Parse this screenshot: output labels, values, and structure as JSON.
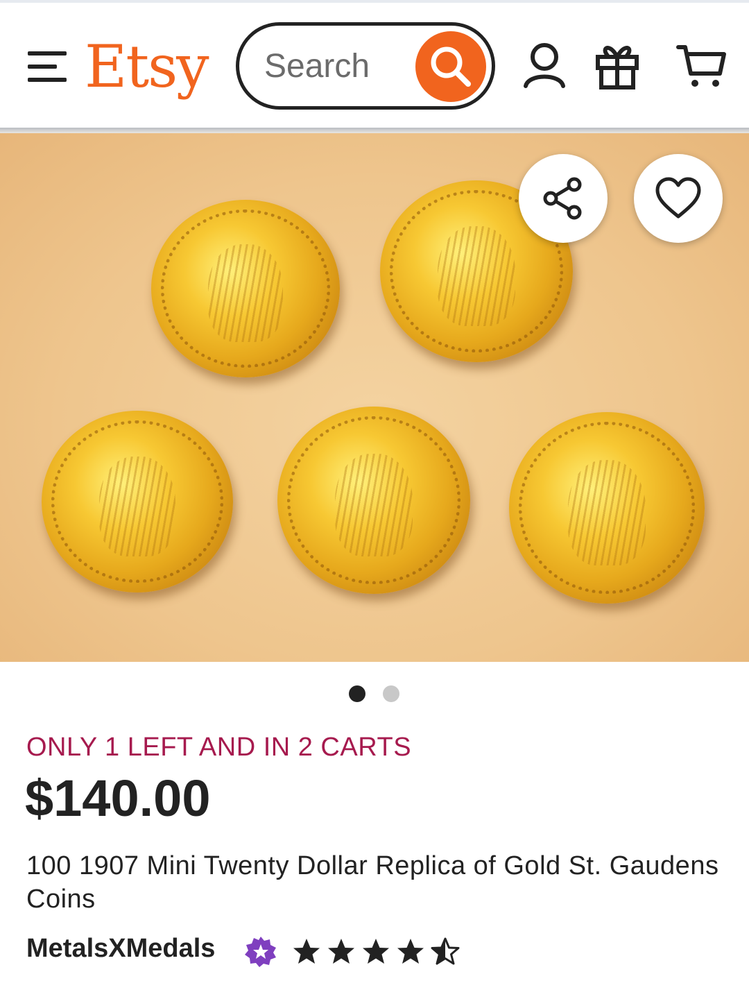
{
  "header": {
    "logo_text": "Etsy",
    "search_placeholder": "Search",
    "brand_color": "#f1641e",
    "icons": [
      "menu-icon",
      "search-icon",
      "account-icon",
      "gift-icon",
      "cart-icon"
    ]
  },
  "hero": {
    "image_description_icons": [
      "share-icon",
      "heart-icon"
    ],
    "carousel": {
      "total": 2,
      "active_index": 0
    }
  },
  "listing": {
    "stock_message": "ONLY 1 LEFT AND IN 2 CARTS",
    "price": "$140.00",
    "title": "100 1907 Mini Twenty Dollar Replica of Gold St. Gaudens Coins",
    "shop_name": "MetalsXMedals",
    "star_seller_badge_color": "#7f3fbf",
    "rating": 4.5,
    "rating_max": 5
  }
}
